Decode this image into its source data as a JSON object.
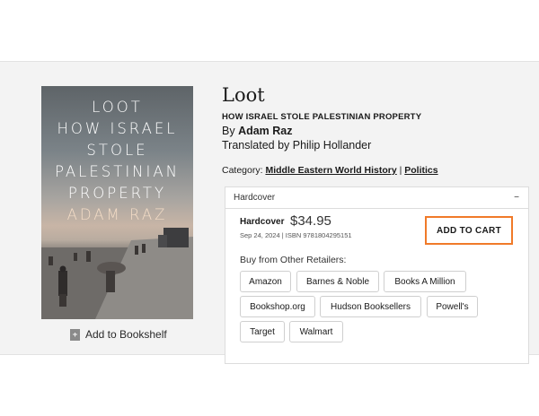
{
  "cover": {
    "title_lines": [
      "LOOT",
      "HOW ISRAEL",
      "STOLE",
      "PALESTINIAN",
      "PROPERTY"
    ],
    "author": "ADAM RAZ"
  },
  "bookshelf": {
    "label": "Add to Bookshelf"
  },
  "book": {
    "title": "Loot",
    "subtitle": "HOW ISRAEL STOLE PALESTINIAN PROPERTY",
    "by_prefix": "By ",
    "author": "Adam Raz",
    "translated": "Translated by Philip Hollander"
  },
  "category": {
    "label": "Category: ",
    "cat1": "Middle Eastern World History",
    "sep": " | ",
    "cat2": "Politics"
  },
  "format_section": {
    "header": "Hardcover",
    "toggle": "−",
    "format_label": "Hardcover",
    "price": "$34.95",
    "pub_info": "Sep 24, 2024 | ISBN 9781804295151",
    "cart_label": "ADD TO CART",
    "other_label": "Buy from Other Retailers:",
    "retailers": [
      "Amazon",
      "Barnes & Noble",
      "Books A Million",
      "Bookshop.org",
      "Hudson Booksellers",
      "Powell's",
      "Target",
      "Walmart"
    ]
  },
  "colors": {
    "accent": "#f07a29",
    "panel_bg": "#f3f3f3"
  }
}
